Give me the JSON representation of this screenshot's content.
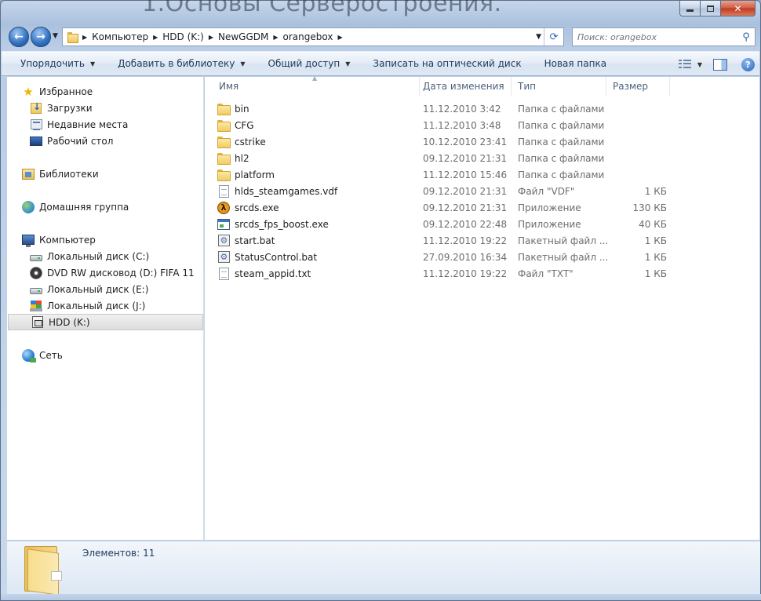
{
  "window": {
    "title_ghost": "1.Основы Серверостроения."
  },
  "address": {
    "crumbs": [
      "Компьютер",
      "HDD (K:)",
      "NewGGDM",
      "orangebox"
    ]
  },
  "search": {
    "placeholder": "Поиск: orangebox"
  },
  "toolbar": {
    "organize": "Упорядочить",
    "add_to_library": "Добавить в библиотеку",
    "share": "Общий доступ",
    "burn": "Записать на оптический диск",
    "new_folder": "Новая папка"
  },
  "sidebar": {
    "favorites": {
      "label": "Избранное",
      "items": [
        "Загрузки",
        "Недавние места",
        "Рабочий стол"
      ]
    },
    "libraries": "Библиотеки",
    "homegroup": "Домашняя группа",
    "computer": {
      "label": "Компьютер",
      "items": [
        "Локальный диск (C:)",
        "DVD RW дисковод (D:) FIFA 11",
        "Локальный диск (E:)",
        "Локальный диск  (J:)",
        "HDD (K:)"
      ]
    },
    "network": "Сеть"
  },
  "columns": {
    "name": "Имя",
    "date": "Дата изменения",
    "type": "Тип",
    "size": "Размер"
  },
  "files": [
    {
      "name": "bin",
      "date": "11.12.2010 3:42",
      "type": "Папка с файлами",
      "size": "",
      "icon": "folder-icon"
    },
    {
      "name": "CFG",
      "date": "11.12.2010 3:48",
      "type": "Папка с файлами",
      "size": "",
      "icon": "folder-icon"
    },
    {
      "name": "cstrike",
      "date": "10.12.2010 23:41",
      "type": "Папка с файлами",
      "size": "",
      "icon": "folder-icon"
    },
    {
      "name": "hl2",
      "date": "09.12.2010 21:31",
      "type": "Папка с файлами",
      "size": "",
      "icon": "folder-icon"
    },
    {
      "name": "platform",
      "date": "11.12.2010 15:46",
      "type": "Папка с файлами",
      "size": "",
      "icon": "folder-icon"
    },
    {
      "name": "hlds_steamgames.vdf",
      "date": "09.12.2010 21:31",
      "type": "Файл \"VDF\"",
      "size": "1 КБ",
      "icon": "document-icon"
    },
    {
      "name": "srcds.exe",
      "date": "09.12.2010 21:31",
      "type": "Приложение",
      "size": "130 КБ",
      "icon": "half-life-icon"
    },
    {
      "name": "srcds_fps_boost.exe",
      "date": "09.12.2010 22:48",
      "type": "Приложение",
      "size": "40 КБ",
      "icon": "application-icon"
    },
    {
      "name": "start.bat",
      "date": "11.12.2010 19:22",
      "type": "Пакетный файл ...",
      "size": "1 КБ",
      "icon": "batch-file-icon"
    },
    {
      "name": "StatusControl.bat",
      "date": "27.09.2010 16:34",
      "type": "Пакетный файл ...",
      "size": "1 КБ",
      "icon": "batch-file-icon"
    },
    {
      "name": "steam_appid.txt",
      "date": "11.12.2010 19:22",
      "type": "Файл \"TXT\"",
      "size": "1 КБ",
      "icon": "document-icon"
    }
  ],
  "details": {
    "items_label": "Элементов:",
    "items_count": "11"
  },
  "colors": {
    "accent": "#1e395b",
    "selection": "#dcdcdc",
    "frame": "#b9cde6"
  }
}
